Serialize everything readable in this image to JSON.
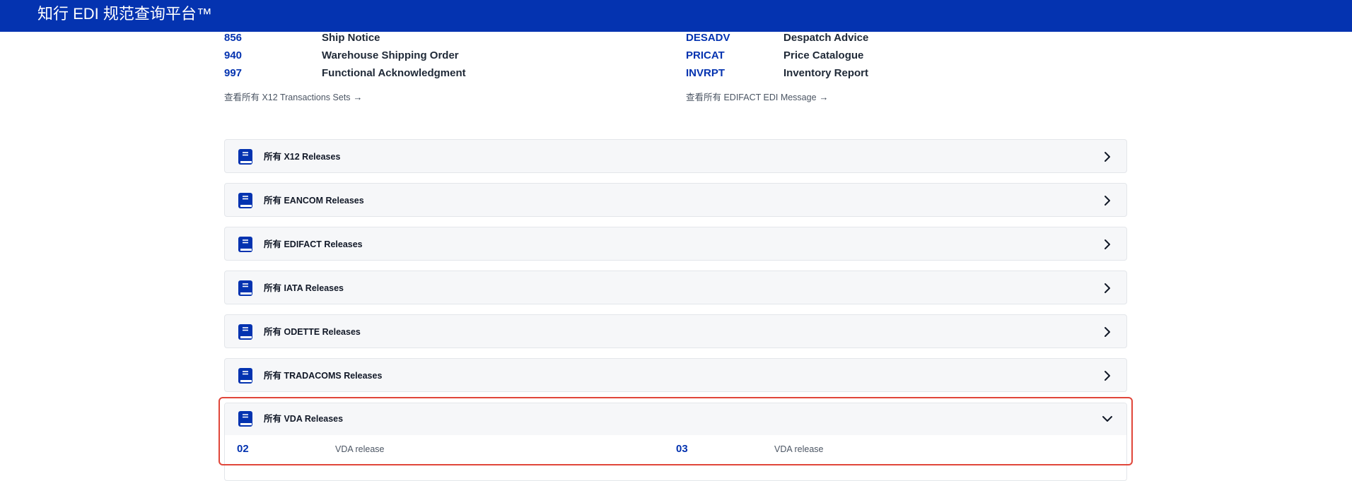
{
  "header": {
    "brand": "知行 EDI 规范查询平台™"
  },
  "x12": {
    "rows": [
      {
        "code": "856",
        "name": "Ship Notice"
      },
      {
        "code": "940",
        "name": "Warehouse Shipping Order"
      },
      {
        "code": "997",
        "name": "Functional Acknowledgment"
      }
    ],
    "view_all": "查看所有 X12 Transactions Sets"
  },
  "edifact": {
    "rows": [
      {
        "code": "DESADV",
        "name": "Despatch Advice"
      },
      {
        "code": "PRICAT",
        "name": "Price Catalogue"
      },
      {
        "code": "INVRPT",
        "name": "Inventory Report"
      }
    ],
    "view_all": "查看所有 EDIFACT EDI Message"
  },
  "arrow_glyph": "→",
  "accordions": [
    {
      "label": "所有 X12 Releases",
      "expanded": false
    },
    {
      "label": "所有 EANCOM Releases",
      "expanded": false
    },
    {
      "label": "所有 EDIFACT Releases",
      "expanded": false
    },
    {
      "label": "所有 IATA Releases",
      "expanded": false
    },
    {
      "label": "所有 ODETTE Releases",
      "expanded": false
    },
    {
      "label": "所有 TRADACOMS Releases",
      "expanded": false
    },
    {
      "label": "所有 VDA Releases",
      "expanded": true
    }
  ],
  "vda_releases": [
    {
      "code": "02",
      "desc": "VDA release"
    },
    {
      "code": "03",
      "desc": "VDA release"
    }
  ],
  "icons": {
    "accordion": "book-icon",
    "collapsed": "chevron-right-icon",
    "expanded": "chevron-down-icon"
  },
  "colors": {
    "brand": "#0433b0",
    "highlight": "#e0463a",
    "panel": "#f6f7f9"
  }
}
